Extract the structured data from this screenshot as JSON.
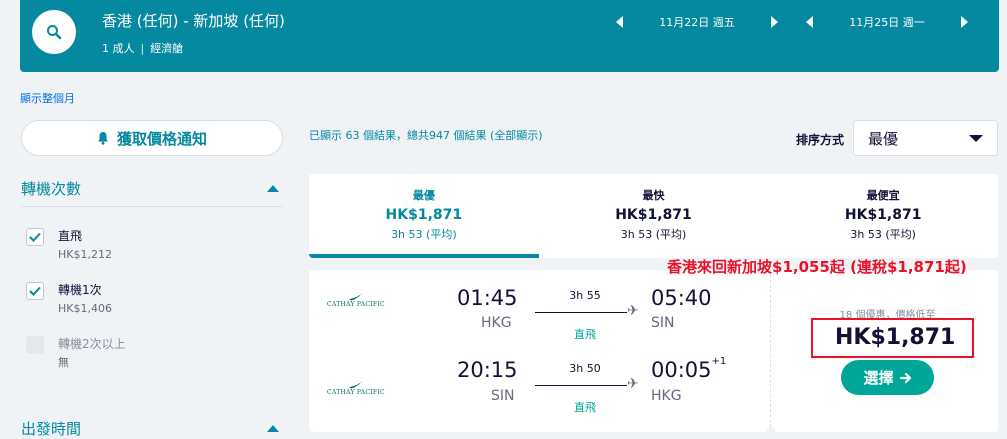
{
  "header": {
    "route": "香港 (任何) - 新加坡 (任何)",
    "passengers": "1 成人",
    "cabin": "經濟艙",
    "outbound_date": "11月22日 週五",
    "return_date": "11月25日 週一"
  },
  "show_month_link": "顯示整個月",
  "price_alert_label": "獲取價格通知",
  "filters": {
    "stops_title": "轉機次數",
    "stops": [
      {
        "label": "直飛",
        "price": "HK$1,212",
        "checked": true
      },
      {
        "label": "轉機1次",
        "price": "HK$1,406",
        "checked": true
      },
      {
        "label": "轉機2次以上",
        "price": "無",
        "checked": false
      }
    ],
    "departure_title": "出發時間"
  },
  "results": {
    "count_text": "已顯示 63 個結果，總共947 個結果 (全部顯示)",
    "sort_label": "排序方式",
    "sort_value": "最優"
  },
  "tabs": [
    {
      "name": "最優",
      "price": "HK$1,871",
      "duration": "3h 53 (平均)",
      "active": true
    },
    {
      "name": "最快",
      "price": "HK$1,871",
      "duration": "3h 53 (平均)",
      "active": false
    },
    {
      "name": "最便宜",
      "price": "HK$1,871",
      "duration": "3h 53 (平均)",
      "active": false
    }
  ],
  "card": {
    "outbound": {
      "airline": "CATHAY PACIFIC",
      "depart_time": "01:45",
      "depart_airport": "HKG",
      "duration": "3h 55",
      "stops": "直飛",
      "arrive_time": "05:40",
      "arrive_airport": "SIN",
      "day_offset": ""
    },
    "inbound": {
      "airline": "CATHAY PACIFIC",
      "depart_time": "20:15",
      "depart_airport": "SIN",
      "duration": "3h 50",
      "stops": "直飛",
      "arrive_time": "00:05",
      "arrive_airport": "HKG",
      "day_offset": "+1"
    },
    "deals_text": "18 個優惠，價格低至",
    "price": "HK$1,871",
    "select_label": "選擇"
  },
  "annotation": "香港來回新加坡$1,055起 (連稅$1,871起)",
  "colors": {
    "brand": "#0589a0",
    "accent_green": "#00a698",
    "annotation_red": "#e8132b"
  }
}
